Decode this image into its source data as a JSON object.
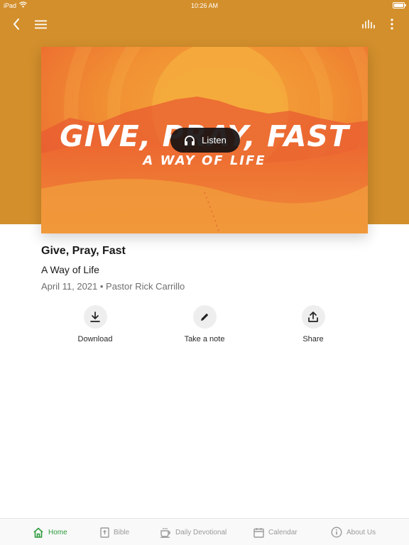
{
  "status_bar": {
    "device": "iPad",
    "time": "10:26 AM"
  },
  "artwork": {
    "title": "GIVE, PRAY, FAST",
    "subtitle": "A WAY OF LIFE",
    "listen_label": "Listen"
  },
  "sermon": {
    "title": "Give, Pray, Fast",
    "series": "A Way of Life",
    "meta": "April 11, 2021 • Pastor Rick Carrillo"
  },
  "actions": {
    "download": "Download",
    "note": "Take a note",
    "share": "Share"
  },
  "tabs": [
    {
      "label": "Home",
      "icon": "home-icon",
      "active": true
    },
    {
      "label": "Bible",
      "icon": "bible-icon"
    },
    {
      "label": "Daily Devotional",
      "icon": "coffee-cup-icon"
    },
    {
      "label": "Calendar",
      "icon": "calendar-icon"
    },
    {
      "label": "About Us",
      "icon": "info-icon"
    }
  ],
  "colors": {
    "header": "#d38f2c",
    "active_tab": "#2d9b3c",
    "artwork_orange": "#f0772f",
    "artwork_sun": "#f6b23a"
  }
}
